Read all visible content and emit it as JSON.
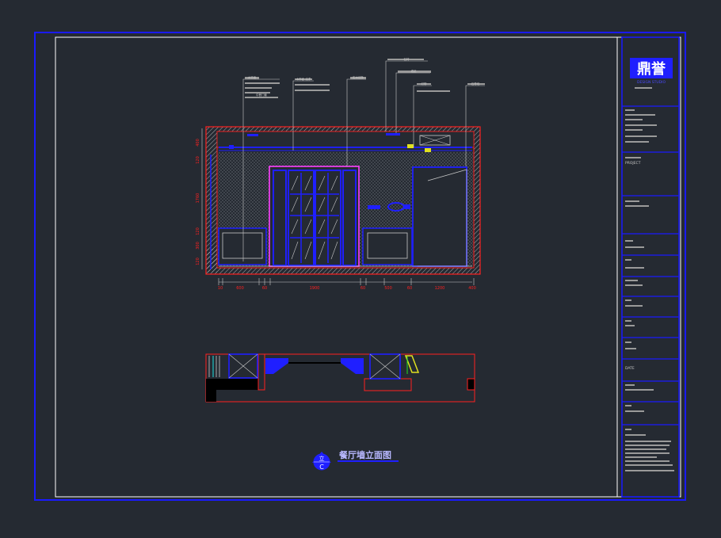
{
  "drawing": {
    "caption": "餐厅墙立面图",
    "view_marker": {
      "top": "立",
      "bottom": "C"
    },
    "dimensions": {
      "vertical": [
        "400",
        "120",
        "1760",
        "120",
        "300",
        "120"
      ],
      "horizontal": [
        "10",
        "600",
        "60",
        "1900",
        "60",
        "500",
        "60",
        "1200",
        "400"
      ]
    },
    "callout_labels": [
      "木饰面",
      "木饰面 油漆",
      "实木线条",
      "石材",
      "墙纸",
      "灯带",
      "石膏线",
      "中餐门套"
    ]
  },
  "title_block": {
    "logo_text": "鼎誉",
    "logo_subtitle": "DESIGN STUDIO",
    "project_label": "PROJECT",
    "date_label": "DATE"
  },
  "colors": {
    "background": "#252a32",
    "border": "#1a1aff",
    "frame": "#ffffff",
    "wall": "#ff2020",
    "furniture": "#1f1fff",
    "door": "#ff40ff",
    "text": "#c8c8c8"
  }
}
